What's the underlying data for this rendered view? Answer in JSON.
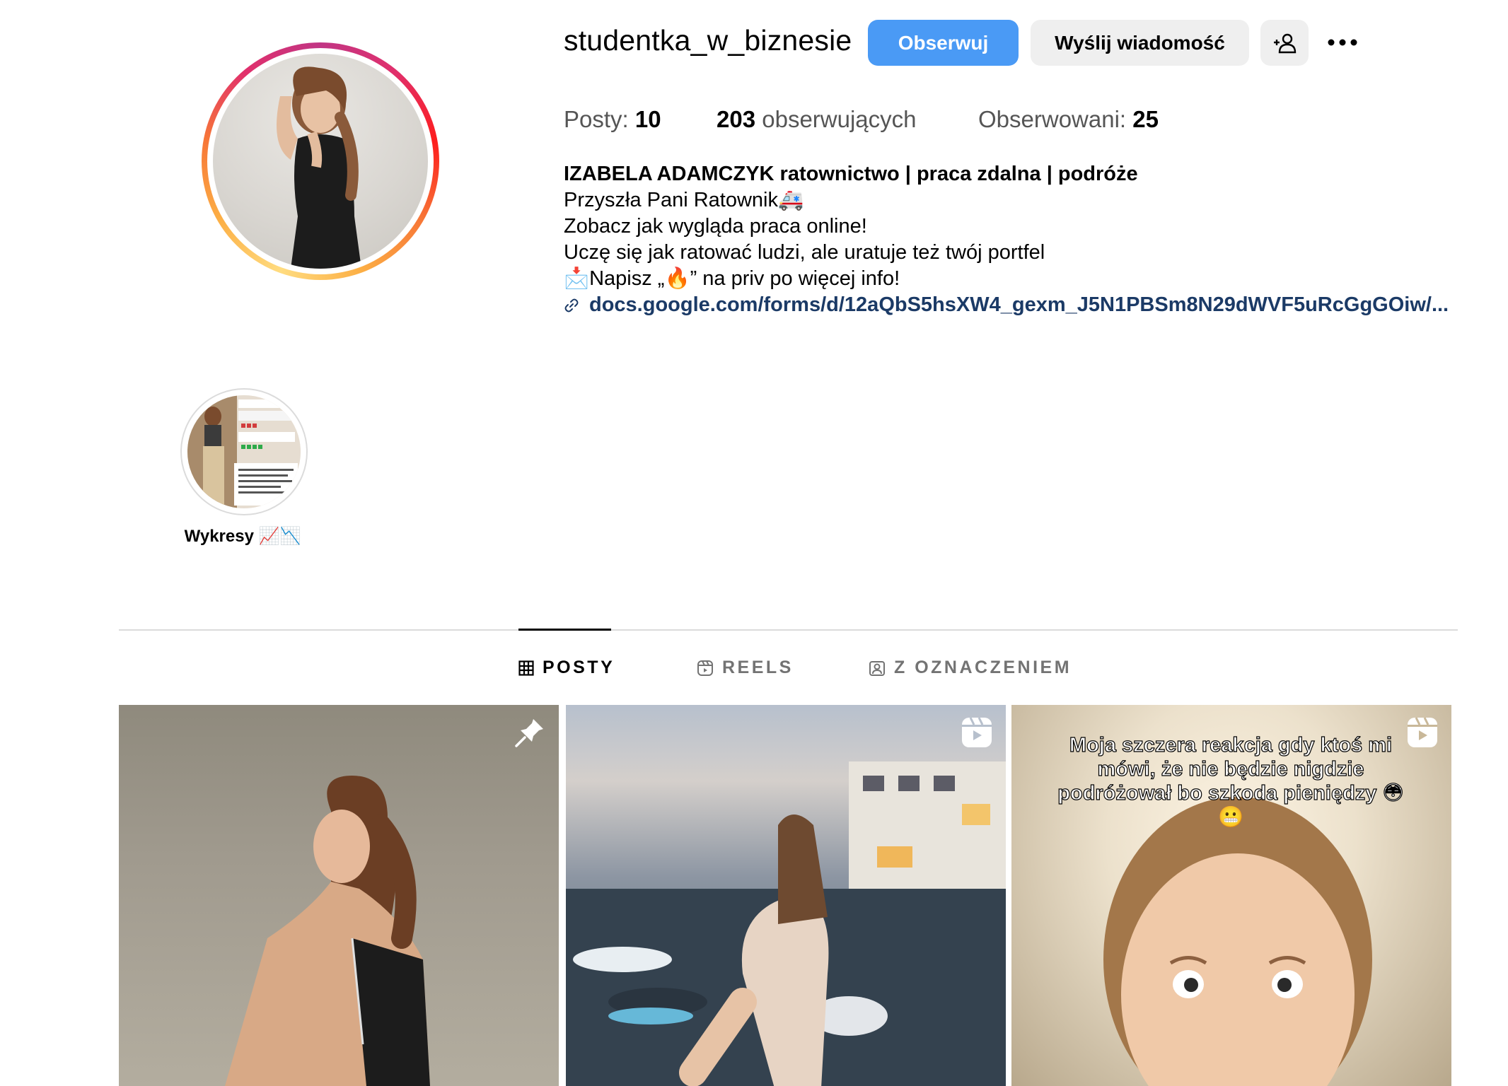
{
  "profile": {
    "username": "studentka_w_biznesie",
    "follow_label": "Obserwuj",
    "message_label": "Wyślij wiadomość",
    "stats": {
      "posts_label": "Posty:",
      "posts_count": "10",
      "followers_count": "203",
      "followers_label": "obserwujących",
      "following_label": "Obserwowani:",
      "following_count": "25"
    },
    "bio": {
      "name": "IZABELA ADAMCZYK ratownictwo | praca zdalna | podróże",
      "line1": "Przyszła Pani Ratownik🚑",
      "line2": "Zobacz jak wygląda praca online!",
      "line3": "Uczę się jak ratować ludzi, ale uratuje też twój portfel",
      "line4": "📩Napisz „🔥” na priv po więcej info!",
      "link": "docs.google.com/forms/d/12aQbS5hsXW4_gexm_J5N1PBSm8N29dWVF5uRcGgGOiw/..."
    }
  },
  "highlights": [
    {
      "label": "Wykresy 📈📉"
    }
  ],
  "tabs": [
    {
      "label": "POSTY",
      "icon": "grid-icon",
      "active": true
    },
    {
      "label": "REELS",
      "icon": "reels-icon",
      "active": false
    },
    {
      "label": "Z OZNACZENIEM",
      "icon": "tagged-icon",
      "active": false
    }
  ],
  "posts": [
    {
      "type": "photo",
      "badge": "pin-icon",
      "caption": ""
    },
    {
      "type": "reel",
      "badge": "reel-icon",
      "caption": ""
    },
    {
      "type": "reel",
      "badge": "reel-icon",
      "caption": "Moja szczera reakcja gdy ktoś mi mówi, że nie będzie nigdzie podróżował bo szkoda pieniędzy 😳😬"
    }
  ],
  "colors": {
    "accent": "#4a9af5",
    "link": "#1b3a66",
    "secondary_button": "#efefef",
    "muted_text": "#737373"
  }
}
